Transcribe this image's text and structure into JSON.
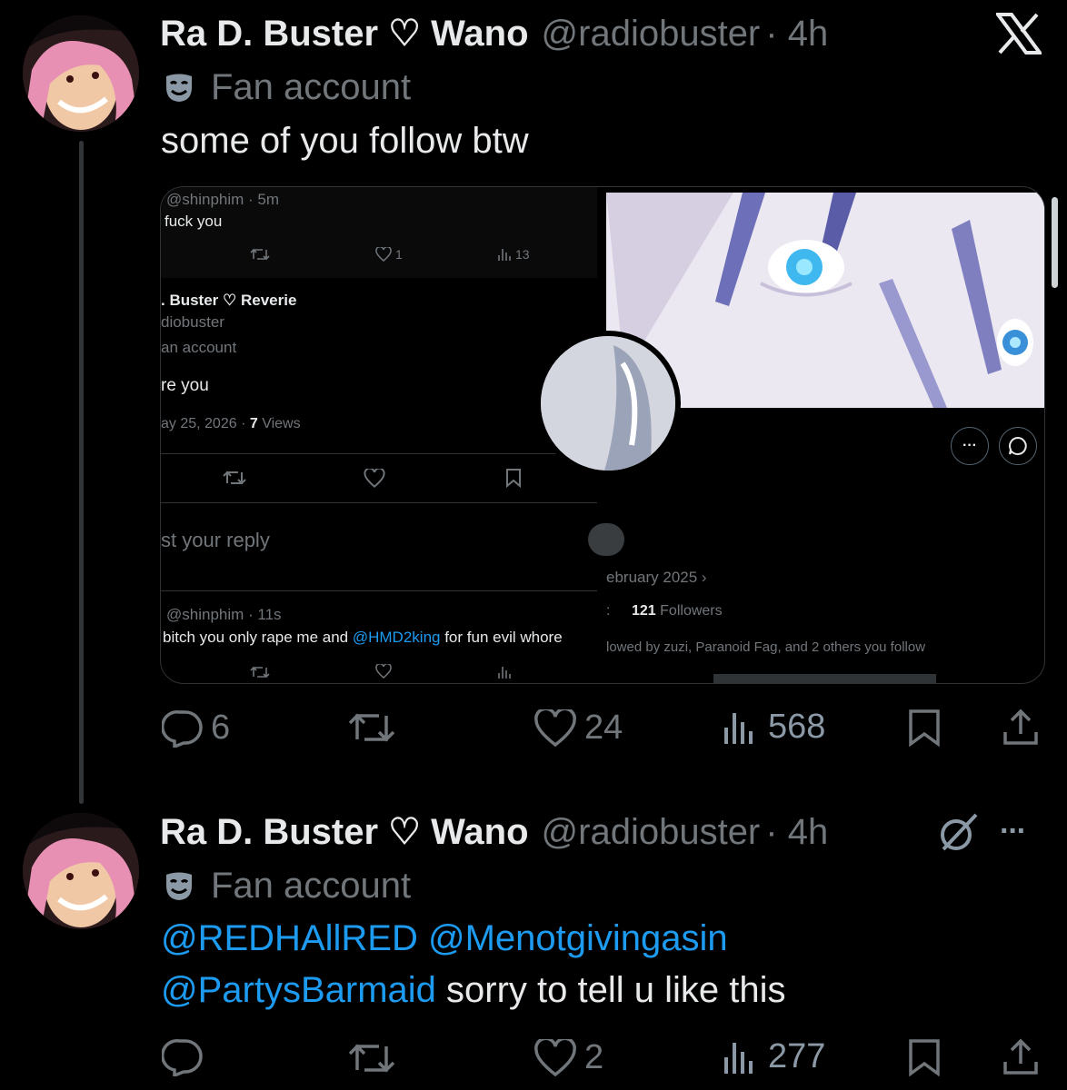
{
  "brand": {
    "logo": "X",
    "accent": "#1d9bf0"
  },
  "tweet1": {
    "name": "Ra D. Buster ♡ Wano",
    "handle": "@radiobuster",
    "time": "· 4h",
    "label": "Fan account",
    "text": "some of you follow btw",
    "actions": {
      "replies": "6",
      "likes": "24",
      "views": "568"
    },
    "media": {
      "left": {
        "reply_handle": "@shinphim · 5m",
        "reply_text": "fuck you",
        "reply_likes": "1",
        "reply_views": "13",
        "main_name": ". Buster ♡ Reverie",
        "main_handle": "diobuster",
        "main_label": "an account",
        "main_text": "re you",
        "main_date": "ay 25, 2026 · ",
        "main_views_count": "7",
        "main_views_label": " Views",
        "compose_placeholder": "st your reply",
        "second_reply_handle": "@shinphim · 11s",
        "second_reply_pre": "bitch you only rape me and ",
        "second_reply_mention": "@HMD2king",
        "second_reply_post": " for fun evil whore"
      },
      "right": {
        "joined": "ebruary 2025 ›",
        "followers_count": "121",
        "followers_label": "Followers",
        "followed_by": "lowed by zuzi, Paranoid Fag, and 2 others you follow"
      }
    }
  },
  "tweet2": {
    "name": "Ra D. Buster ♡ Wano",
    "handle": "@radiobuster",
    "time": "· 4h",
    "label": "Fan account",
    "mention1": "@REDHAllRED",
    "mention2": "@Menotgivingasin",
    "mention3": "@PartysBarmaid",
    "text": "sorry to tell u like this",
    "actions": {
      "replies": "",
      "likes": "2",
      "views": "277"
    }
  }
}
